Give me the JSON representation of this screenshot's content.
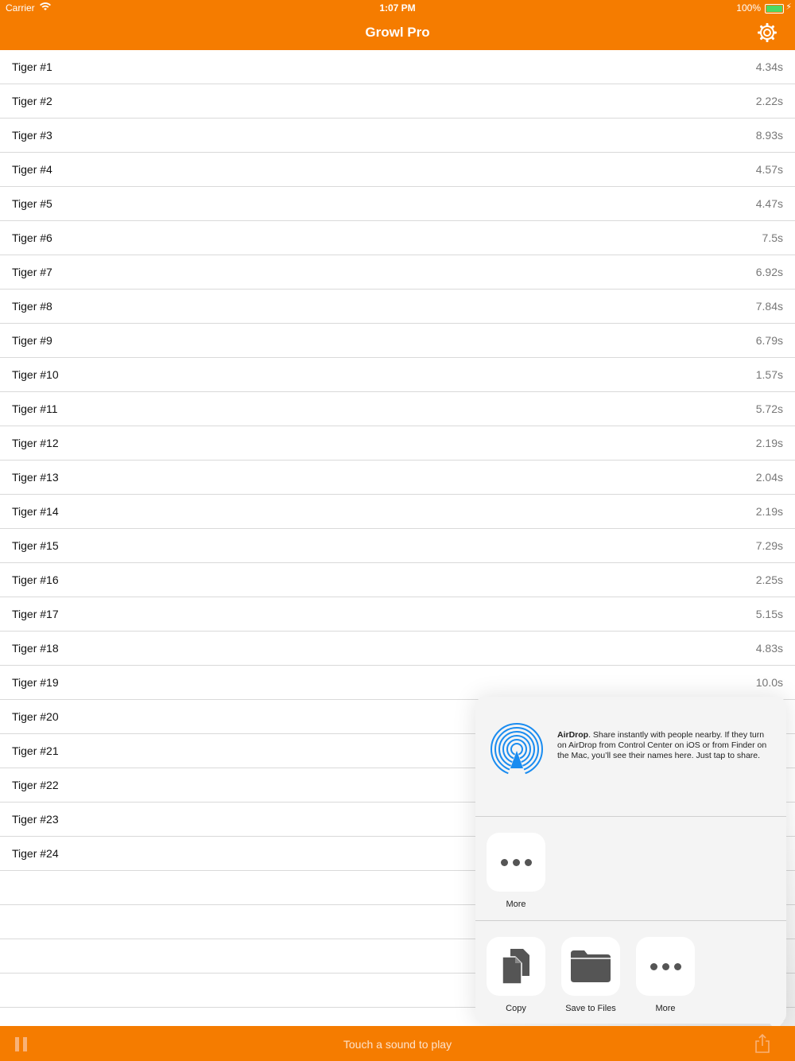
{
  "status_bar": {
    "carrier": "Carrier",
    "time": "1:07 PM",
    "battery": "100%",
    "battery_level": 1.0
  },
  "header": {
    "title": "Growl Pro",
    "settings_icon": "gear-icon"
  },
  "sounds": [
    {
      "name": "Tiger #1",
      "duration": "4.34s"
    },
    {
      "name": "Tiger #2",
      "duration": "2.22s"
    },
    {
      "name": "Tiger #3",
      "duration": "8.93s"
    },
    {
      "name": "Tiger #4",
      "duration": "4.57s"
    },
    {
      "name": "Tiger #5",
      "duration": "4.47s"
    },
    {
      "name": "Tiger #6",
      "duration": "7.5s"
    },
    {
      "name": "Tiger #7",
      "duration": "6.92s"
    },
    {
      "name": "Tiger #8",
      "duration": "7.84s"
    },
    {
      "name": "Tiger #9",
      "duration": "6.79s"
    },
    {
      "name": "Tiger #10",
      "duration": "1.57s"
    },
    {
      "name": "Tiger #11",
      "duration": "5.72s"
    },
    {
      "name": "Tiger #12",
      "duration": "2.19s"
    },
    {
      "name": "Tiger #13",
      "duration": "2.04s"
    },
    {
      "name": "Tiger #14",
      "duration": "2.19s"
    },
    {
      "name": "Tiger #15",
      "duration": "7.29s"
    },
    {
      "name": "Tiger #16",
      "duration": "2.25s"
    },
    {
      "name": "Tiger #17",
      "duration": "5.15s"
    },
    {
      "name": "Tiger #18",
      "duration": "4.83s"
    },
    {
      "name": "Tiger #19",
      "duration": "10.0s"
    },
    {
      "name": "Tiger #20",
      "duration": ""
    },
    {
      "name": "Tiger #21",
      "duration": ""
    },
    {
      "name": "Tiger #22",
      "duration": ""
    },
    {
      "name": "Tiger #23",
      "duration": ""
    },
    {
      "name": "Tiger #24",
      "duration": ""
    },
    {
      "name": "",
      "duration": ""
    },
    {
      "name": "",
      "duration": ""
    },
    {
      "name": "",
      "duration": ""
    },
    {
      "name": "",
      "duration": ""
    }
  ],
  "share_sheet": {
    "airdrop_title": "AirDrop",
    "airdrop_text": ". Share instantly with people nearby. If they turn on AirDrop from Control Center on iOS or from Finder on the Mac, you’ll see their names here. Just tap to share.",
    "apps": [
      {
        "label": "More",
        "icon": "more-icon"
      }
    ],
    "actions": [
      {
        "label": "Copy",
        "icon": "copy-icon"
      },
      {
        "label": "Save to Files",
        "icon": "folder-icon"
      },
      {
        "label": "More",
        "icon": "more-icon"
      }
    ]
  },
  "bottom_bar": {
    "hint": "Touch a sound to play",
    "pause_icon": "pause-icon",
    "share_icon": "share-icon"
  },
  "colors": {
    "accent": "#f57c00",
    "airdrop_blue": "#1a8cf0"
  }
}
